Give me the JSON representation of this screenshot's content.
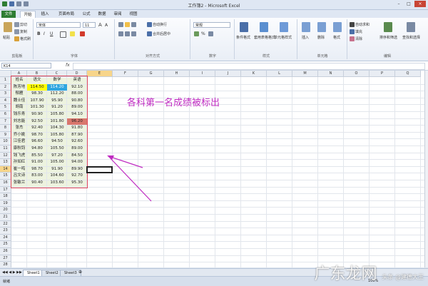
{
  "window": {
    "title": "工作簿2 - Microsoft Excel",
    "minimize": "–",
    "maximize": "□",
    "close": "×"
  },
  "tabs": [
    "文件",
    "开始",
    "插入",
    "页面布局",
    "公式",
    "数据",
    "审阅",
    "视图"
  ],
  "ribbon": {
    "clipboard": {
      "name": "剪贴板",
      "paste": "粘贴",
      "cut": "剪切",
      "copy": "复制",
      "format_painter": "格式刷"
    },
    "font": {
      "name": "字体",
      "font_name": "宋体",
      "font_size": "11",
      "bold": "B",
      "italic": "I",
      "underline": "U"
    },
    "alignment": {
      "name": "对齐方式",
      "wrap": "自动换行",
      "merge": "合并后居中"
    },
    "number": {
      "name": "数字",
      "format": "常规",
      "percent": "%"
    },
    "styles": {
      "name": "样式",
      "conditional": "条件格式",
      "table": "套用表格格式",
      "cell_styles": "单元格样式"
    },
    "cells": {
      "name": "单元格",
      "insert": "插入",
      "delete": "删除",
      "format": "格式"
    },
    "editing": {
      "name": "编辑",
      "autosum": "自动求和",
      "fill": "填充",
      "clear": "清除",
      "sort": "排序和筛选",
      "find": "查找和选择"
    }
  },
  "formula_bar": {
    "name_box": "K14",
    "fx": "fx"
  },
  "columns": [
    "A",
    "B",
    "C",
    "D",
    "E",
    "F",
    "G",
    "H",
    "I",
    "J",
    "K",
    "L",
    "M",
    "N",
    "O",
    "P",
    "Q"
  ],
  "selected_column": "E",
  "selected_row": 14,
  "table": {
    "header": [
      "姓名",
      "语文",
      "数学",
      "英语"
    ],
    "rows": [
      [
        "陈芳地",
        "114.50",
        "114.20",
        "92.10"
      ],
      [
        "郁雁",
        "98.30",
        "112.20",
        "88.00"
      ],
      [
        "魏士佳",
        "107.90",
        "95.90",
        "90.80"
      ],
      [
        "胡南",
        "101.30",
        "91.20",
        "89.00"
      ],
      [
        "钱乐青",
        "90.90",
        "105.80",
        "94.10"
      ],
      [
        "刘志能",
        "92.50",
        "101.80",
        "96.20"
      ],
      [
        "张杰",
        "92.40",
        "104.30",
        "91.80"
      ],
      [
        "乔小姚",
        "98.70",
        "105.80",
        "87.90"
      ],
      [
        "江佳君",
        "96.60",
        "94.50",
        "92.60"
      ],
      [
        "康秋钧",
        "94.80",
        "105.50",
        "89.00"
      ],
      [
        "钱飞虎",
        "85.50",
        "97.20",
        "84.50"
      ],
      [
        "孙如红",
        "91.00",
        "105.00",
        "94.00"
      ],
      [
        "崔一鸣",
        "98.70",
        "91.90",
        "89.90"
      ],
      [
        "吕文诗",
        "83.00",
        "104.60",
        "92.70"
      ],
      [
        "张敏兰",
        "90.40",
        "103.60",
        "95.30"
      ]
    ]
  },
  "highlights": {
    "yuwen_color": "#ffff00",
    "shuxue_color": "#2ea6e0",
    "yingyu_color": "#d9776d"
  },
  "annotation": "各科第一名成绩被标出",
  "sheets": [
    "Sheet1",
    "Sheet2",
    "Sheet3"
  ],
  "status": {
    "ready": "就绪",
    "zoom": "100%"
  },
  "watermark": {
    "brand": "广东龙网",
    "sub": "头条 @建德大王"
  }
}
